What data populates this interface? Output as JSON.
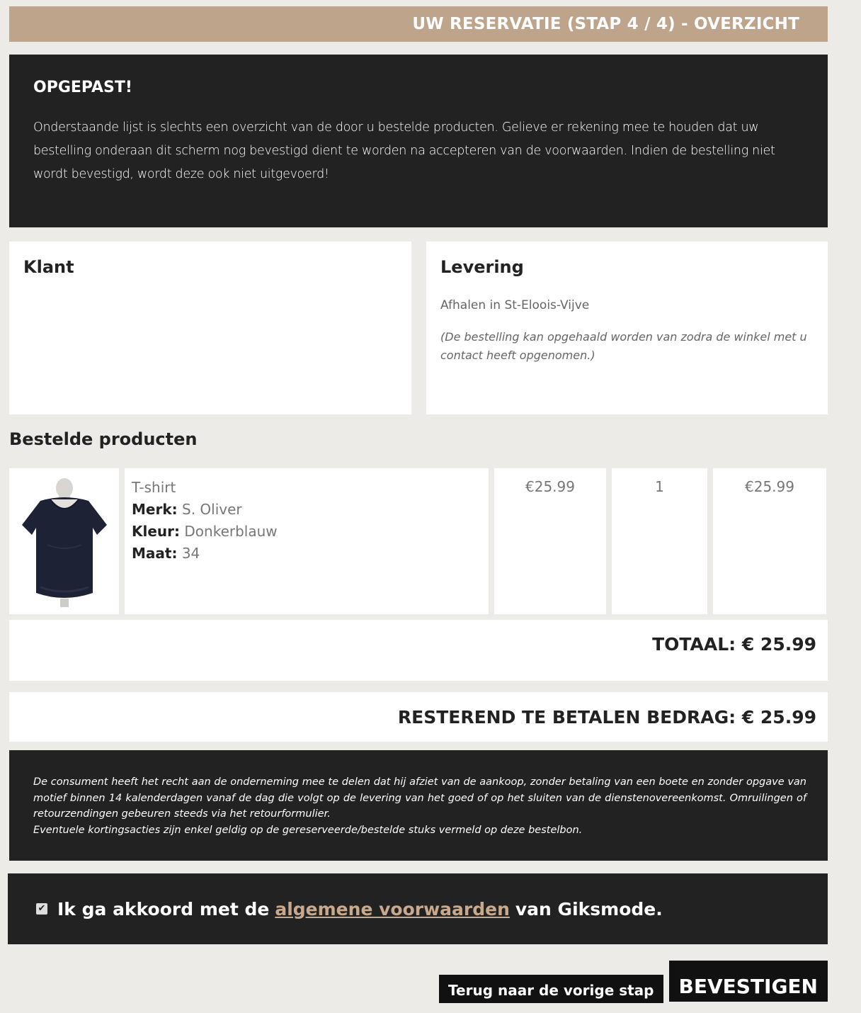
{
  "header": {
    "title": "UW RESERVATIE (STAP 4 / 4) - OVERZICHT"
  },
  "notice": {
    "title": "OPGEPAST!",
    "text": "Onderstaande lijst is slechts een overzicht van de door u bestelde producten. Gelieve er rekening mee te houden dat uw bestelling onderaan dit scherm nog bevestigd dient te worden na accepteren van de voorwaarden. Indien de bestelling niet wordt bevestigd, wordt deze ook niet uitgevoerd!"
  },
  "klant": {
    "heading": "Klant"
  },
  "levering": {
    "heading": "Levering",
    "method": "Afhalen in St-Eloois-Vijve",
    "note": "(De bestelling kan opgehaald worden van zodra de winkel met u contact heeft opgenomen.)"
  },
  "products": {
    "title": "Bestelde producten",
    "items": [
      {
        "name": "T-shirt",
        "brand_label": "Merk:",
        "brand": "S. Oliver",
        "color_label": "Kleur:",
        "color": "Donkerblauw",
        "size_label": "Maat:",
        "size": "34",
        "price": "€25.99",
        "quantity": "1",
        "total": "€25.99"
      }
    ]
  },
  "totals": {
    "total": "TOTAAL: € 25.99",
    "remaining": "RESTEREND TE BETALEN BEDRAG: € 25.99"
  },
  "legal": {
    "line1": "De consument heeft het recht aan de onderneming mee te delen dat hij afziet van de aankoop, zonder betaling van een boete en zonder opgave van motief binnen 14 kalenderdagen vanaf de dag die volgt op de levering van het goed of op het sluiten van de dienstenovereenkomst. Omruilingen of retourzendingen gebeuren steeds via het retourformulier.",
    "line2": "Eventuele kortingsacties zijn enkel geldig op de gereserveerde/bestelde stuks vermeld op deze bestelbon."
  },
  "agreement": {
    "prefix": "Ik ga akkoord met de",
    "link": "algemene voorwaarden",
    "suffix": "van Giksmode."
  },
  "actions": {
    "back_label": "Terug naar de vorige stap",
    "confirm_label": "BEVESTIGEN"
  },
  "colors": {
    "accent": "#bfa48c",
    "dark": "#222222",
    "link": "#c9a98d"
  }
}
